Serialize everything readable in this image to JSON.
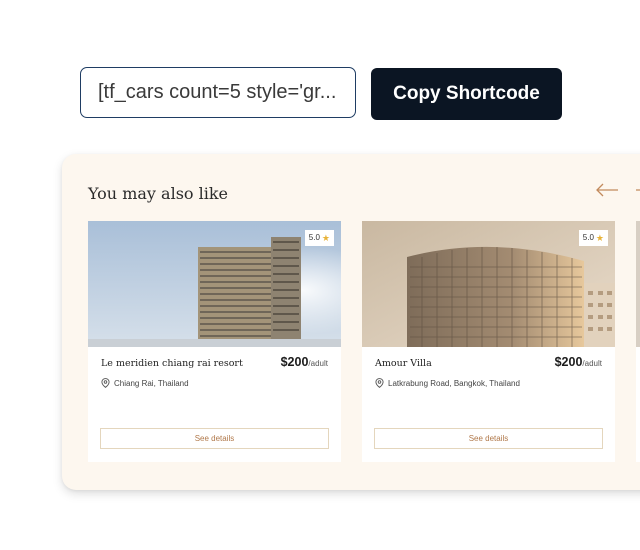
{
  "shortcode": {
    "value": "[tf_cars count=5 style='gr...",
    "copy_label": "Copy Shortcode"
  },
  "section": {
    "title": "You may also like",
    "arrow_prev": "left-arrow-icon",
    "arrow_next": "right-arrow-icon"
  },
  "cards": [
    {
      "name": "Le meridien chiang rai resort",
      "price": "$200",
      "unit": "/adult",
      "location": "Chiang Rai, Thailand",
      "rating": "5.0",
      "button": "See details"
    },
    {
      "name": "Amour Villa",
      "price": "$200",
      "unit": "/adult",
      "location": "Latkrabung Road, Bangkok, Thailand",
      "rating": "5.0",
      "button": "See details"
    }
  ],
  "colors": {
    "button_dark": "#0b1523",
    "panel_bg": "#fdf7ef",
    "accent": "#b0784a",
    "star": "#e8b339"
  }
}
